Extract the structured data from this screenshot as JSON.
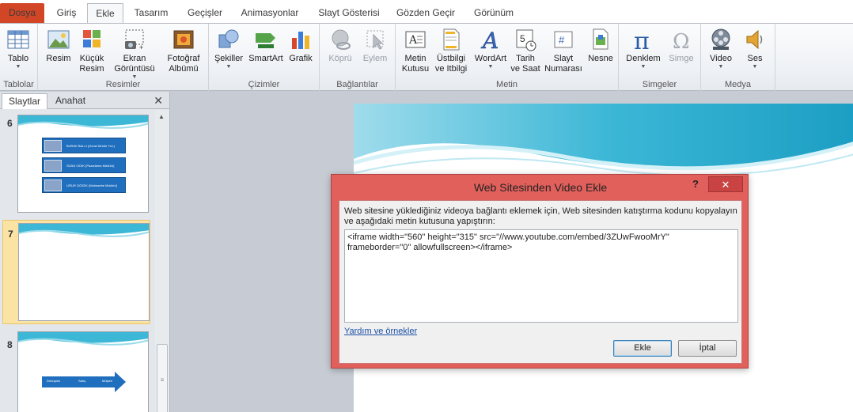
{
  "tabs": {
    "dosya": "Dosya",
    "giris": "Giriş",
    "ekle": "Ekle",
    "tasarim": "Tasarım",
    "gecisler": "Geçişler",
    "animasyonlar": "Animasyonlar",
    "slayt_gosterisi": "Slayt Gösterisi",
    "gozden_gecir": "Gözden Geçir",
    "gorunum": "Görünüm"
  },
  "ribbon": {
    "groups": {
      "tablolar": "Tablolar",
      "resimler": "Resimler",
      "cizimler": "Çizimler",
      "baglantilar": "Bağlantılar",
      "metin": "Metin",
      "simgeler": "Simgeler",
      "medya": "Medya"
    },
    "buttons": {
      "tablo": "Tablo",
      "resim": "Resim",
      "kucuk_resim_1": "Küçük",
      "kucuk_resim_2": "Resim",
      "ekran_goruntusu_1": "Ekran",
      "ekran_goruntusu_2": "Görüntüsü",
      "fotograf_albumu_1": "Fotoğraf",
      "fotograf_albumu_2": "Albümü",
      "sekiller": "Şekiller",
      "smartart": "SmartArt",
      "grafik": "Grafik",
      "kopru": "Köprü",
      "eylem": "Eylem",
      "metin_kutusu_1": "Metin",
      "metin_kutusu_2": "Kutusu",
      "ustbilgi_1": "Üstbilgi",
      "ustbilgi_2": "ve Itbilgi",
      "wordart": "WordArt",
      "tarih_saat_1": "Tarih",
      "tarih_saat_2": "ve Saat",
      "slayt_numarasi_1": "Slayt",
      "slayt_numarasi_2": "Numarası",
      "nesne": "Nesne",
      "denklem": "Denklem",
      "simge": "Simge",
      "video": "Video",
      "ses": "Ses"
    }
  },
  "left_panel": {
    "tab_slaytlar": "Slaytlar",
    "tab_anahat": "Anahat",
    "close": "✕",
    "slides": [
      {
        "number": "6",
        "boxes": [
          "BURAK BALLI (Genel Müdür Yrd.)",
          "ÖZAN CİDİK (Pazarlama Müdürü)",
          "UĞUR GÖZEK (Muhasebe Müdürü)"
        ]
      },
      {
        "number": "7"
      },
      {
        "number": "8",
        "arrow_labels": [
          "Dönüşüm",
          "Satış",
          "Müşteri"
        ]
      }
    ]
  },
  "dialog": {
    "title": "Web Sitesinden Video Ekle",
    "help": "?",
    "close": "✕",
    "instruction": "Web sitesine yüklediğiniz videoya bağlantı eklemek için, Web sitesinden katıştırma kodunu kopyalayın ve aşağıdaki metin kutusuna yapıştırın:",
    "embed_code": "<iframe width=\"560\" height=\"315\" src=\"//www.youtube.com/embed/3ZUwFwooMrY\" frameborder=\"0\" allowfullscreen></iframe>",
    "help_link": "Yardım ve örnekler",
    "ok_button": "Ekle",
    "cancel_button": "İptal"
  },
  "colors": {
    "file_tab": "#d24626",
    "dialog_frame": "#e1605c",
    "close_button": "#c94342",
    "wave": "#3cb7d6",
    "smartart_box": "#1f6fbe"
  }
}
